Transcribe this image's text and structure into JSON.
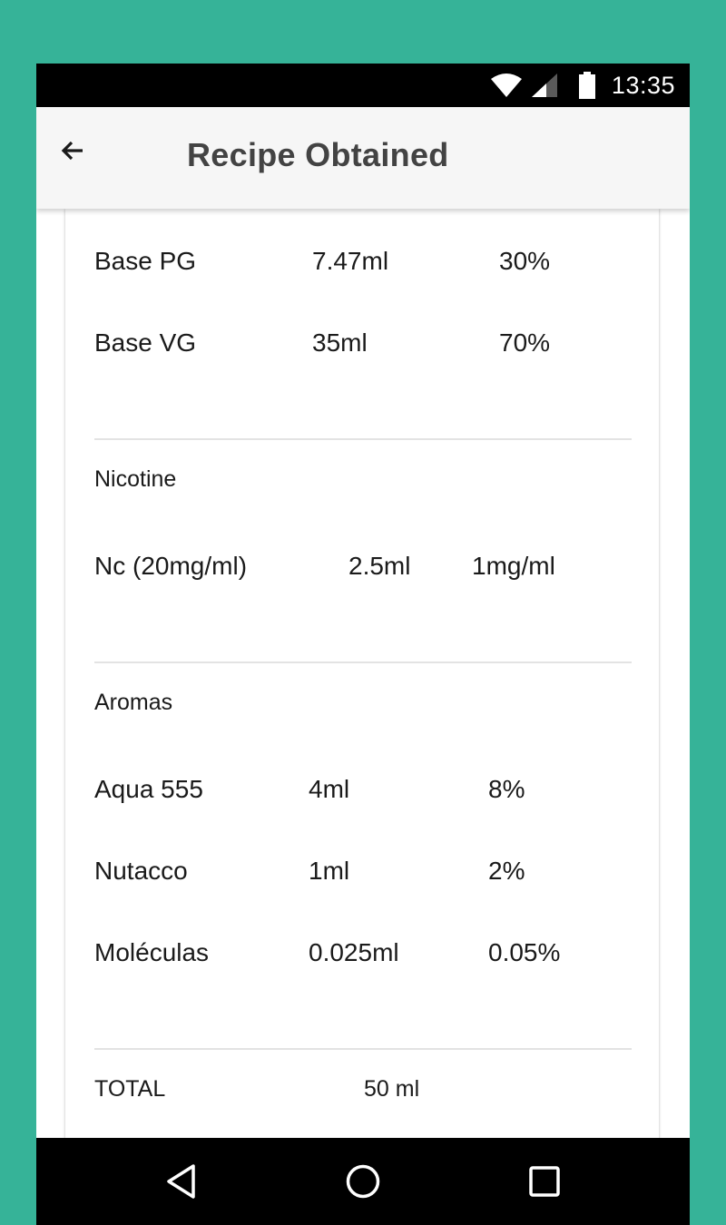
{
  "status_bar": {
    "time": "13:35",
    "icons": [
      "wifi-icon",
      "signal-icon",
      "battery-icon"
    ]
  },
  "app_bar": {
    "title": "Recipe Obtained",
    "back_icon": "arrow-left-icon"
  },
  "bases": [
    {
      "name": "Base PG",
      "amount": "7.47ml",
      "percent": "30%"
    },
    {
      "name": "Base VG",
      "amount": "35ml",
      "percent": "70%"
    }
  ],
  "nicotine": {
    "label": "Nicotine",
    "items": [
      {
        "name": "Nc (20mg/ml)",
        "amount": "2.5ml",
        "strength": "1mg/ml"
      }
    ]
  },
  "aromas": {
    "label": "Aromas",
    "items": [
      {
        "name": "Aqua 555",
        "amount": "4ml",
        "percent": "8%"
      },
      {
        "name": "Nutacco",
        "amount": "1ml",
        "percent": "2%"
      },
      {
        "name": "Moléculas",
        "amount": "0.025ml",
        "percent": "0.05%"
      }
    ]
  },
  "total": {
    "label": "TOTAL",
    "value": "50 ml"
  },
  "nav_bar": {
    "icons": [
      "back-triangle-icon",
      "home-circle-icon",
      "recents-square-icon"
    ]
  },
  "colors": {
    "background": "#36b398",
    "app_bar": "#f6f6f6",
    "title_text": "#434343",
    "system_bars": "#000000"
  }
}
